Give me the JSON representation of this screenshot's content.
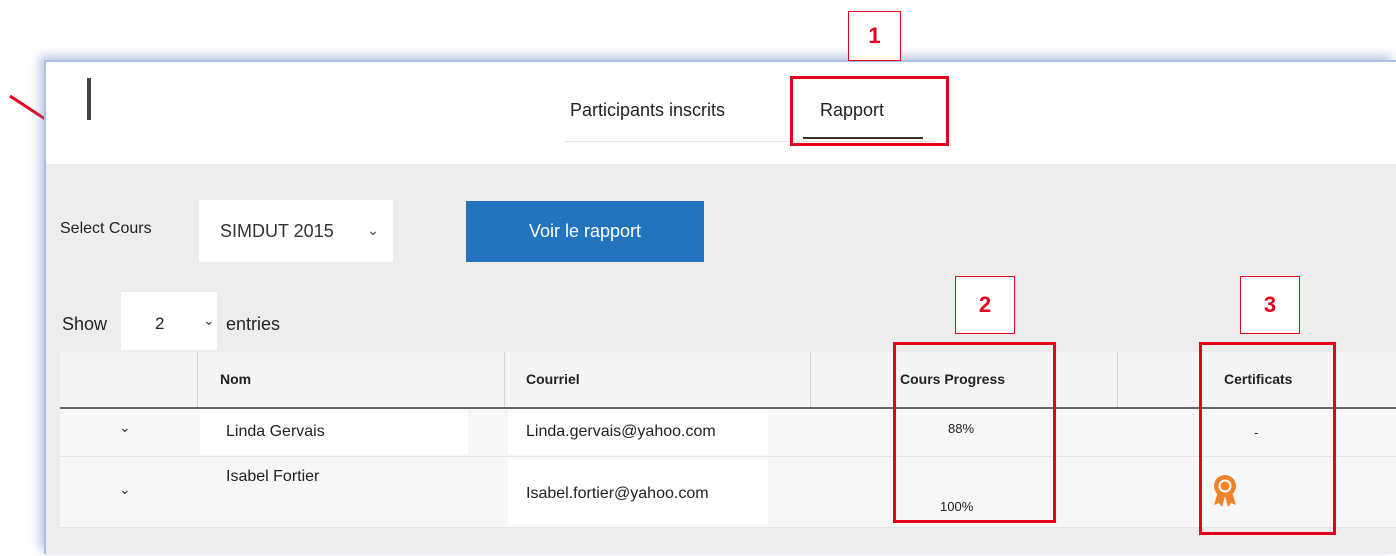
{
  "tabs": [
    {
      "label": "Participants inscrits"
    },
    {
      "label": "Rapport"
    }
  ],
  "controls": {
    "select_label": "Select Cours",
    "course_value": "SIMDUT 2015",
    "report_button": "Voir le rapport",
    "show_label": "Show",
    "entries_value": "2",
    "entries_label": "entries"
  },
  "table": {
    "headers": [
      "Nom",
      "Courriel",
      "Cours Progress",
      "Certificats"
    ],
    "rows": [
      {
        "nom": "Linda Gervais",
        "courriel": "Linda.gervais@yahoo.com",
        "progress": "88%",
        "certificat": "-"
      },
      {
        "nom": "Isabel Fortier",
        "courriel": "Isabel.fortier@yahoo.com",
        "progress": "100%",
        "certificat": "certificate-ribbon-icon"
      }
    ]
  },
  "annotations": [
    "1",
    "2",
    "3"
  ],
  "colors": {
    "accent_button": "#2474bd",
    "annotation_red": "#e3001b",
    "certificate_orange": "#f0822a"
  }
}
